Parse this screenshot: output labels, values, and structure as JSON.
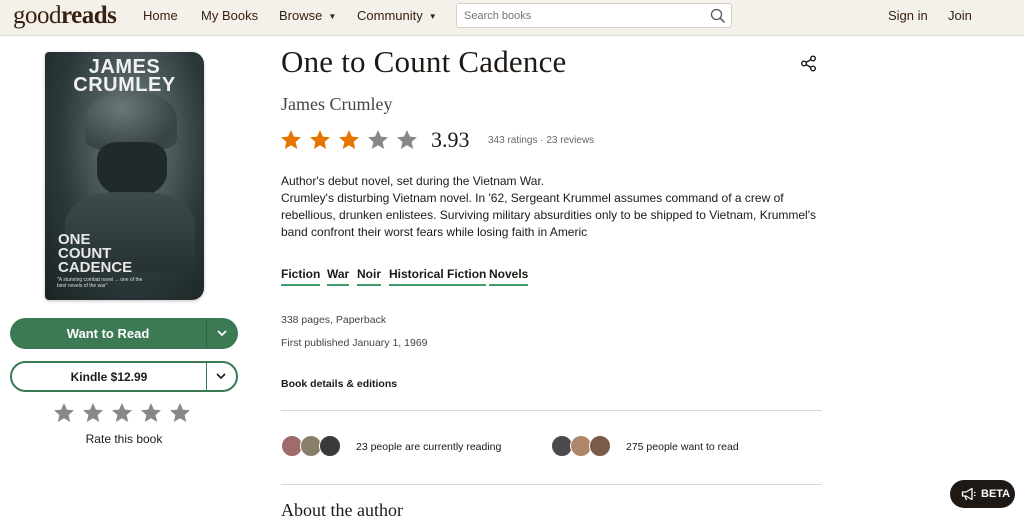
{
  "header": {
    "logo_light": "good",
    "logo_bold": "reads",
    "nav": {
      "home": "Home",
      "my_books": "My Books",
      "browse": "Browse",
      "community": "Community"
    },
    "search_placeholder": "Search books",
    "sign_in": "Sign in",
    "join": "Join"
  },
  "cover": {
    "author_line1": "JAMES",
    "author_line2": "CRUMLEY",
    "title_line1": "ONE",
    "title_line2": "COUNT",
    "title_line3": "CADENCE",
    "blurb": "\"A stunning combat novel ... one of the best novels of the war\""
  },
  "actions": {
    "want_to_read": "Want to Read",
    "kindle": "Kindle $12.99",
    "rate_label": "Rate this book"
  },
  "book": {
    "title": "One to Count Cadence",
    "author": "James Crumley",
    "rating_value": 3.93,
    "average_rating": "3.93",
    "meta": "343 ratings · 23 reviews",
    "description_line1": "Author's debut novel, set during the Vietnam War.",
    "description_line2": "Crumley's disturbing Vietnam novel. In '62, Sergeant Krummel assumes command of a crew of rebellious, drunken enlistees. Surviving military absurdities only to be shipped to Vietnam, Krummel's band confront their worst fears while losing faith in Americ",
    "genres": [
      "Fiction",
      "War",
      "Noir",
      "Historical Fiction",
      "Novels"
    ],
    "pages": "338 pages, Paperback",
    "first_published": "First published January 1, 1969",
    "details_link": "Book details & editions"
  },
  "social": {
    "currently_reading": "23 people are currently reading",
    "want_to_read": "275 people want to read"
  },
  "about_heading": "About the author",
  "beta_label": "BETA",
  "colors": {
    "header_bg": "#f4f1ea",
    "brand_green": "#3c7a54",
    "star_orange": "#e87400",
    "star_grey": "#888888"
  }
}
